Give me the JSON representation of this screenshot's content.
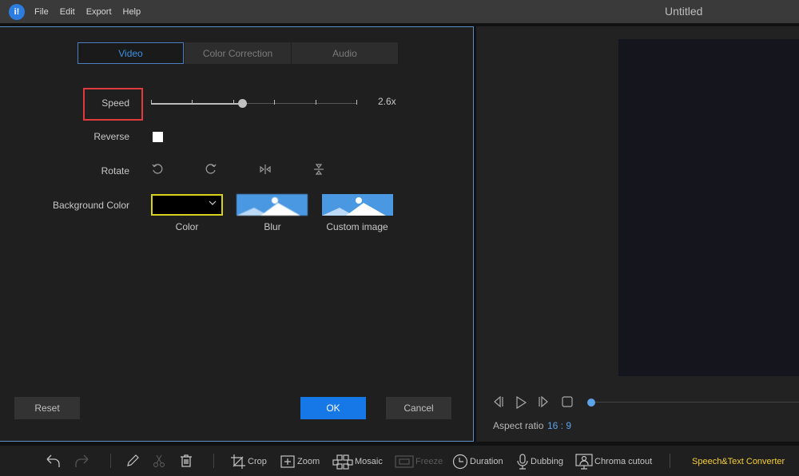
{
  "app": {
    "logo_text": "i!",
    "title": "Untitled",
    "menu": [
      "File",
      "Edit",
      "Export",
      "Help"
    ]
  },
  "dialog": {
    "tabs": [
      {
        "label": "Video",
        "active": true
      },
      {
        "label": "Color Correction",
        "active": false
      },
      {
        "label": "Audio",
        "active": false
      }
    ],
    "speed": {
      "label": "Speed",
      "value_text": "2.6x",
      "slider_fraction": 0.44,
      "tick_count": 6
    },
    "reverse": {
      "label": "Reverse",
      "checked": false
    },
    "rotate": {
      "label": "Rotate",
      "icons": [
        "rotate-left-icon",
        "rotate-right-icon",
        "flip-horizontal-icon",
        "flip-vertical-icon"
      ]
    },
    "background": {
      "label": "Background Color",
      "options": [
        {
          "label": "Color",
          "selected": true,
          "value_color": "#000000"
        },
        {
          "label": "Blur"
        },
        {
          "label": "Custom image"
        }
      ]
    },
    "buttons": {
      "reset": "Reset",
      "ok": "OK",
      "cancel": "Cancel"
    }
  },
  "preview": {
    "aspect_label": "Aspect ratio",
    "aspect_value": "16 : 9",
    "progress_fraction": 0.0
  },
  "toolbar": {
    "items": [
      {
        "label": "Crop",
        "icon": "crop-icon"
      },
      {
        "label": "Zoom",
        "icon": "zoom-icon"
      },
      {
        "label": "Mosaic",
        "icon": "mosaic-icon"
      },
      {
        "label": "Freeze",
        "icon": "freeze-icon",
        "disabled": true
      },
      {
        "label": "Duration",
        "icon": "clock-icon"
      },
      {
        "label": "Dubbing",
        "icon": "microphone-icon"
      },
      {
        "label": "Chroma cutout",
        "icon": "chroma-icon"
      }
    ],
    "speech_text": "Speech&Text Converter"
  },
  "colors": {
    "accent": "#1678e6",
    "highlight_red": "#e03a3a",
    "color_select_border": "#d6d21d",
    "speech_yellow": "#f5cf3a"
  }
}
